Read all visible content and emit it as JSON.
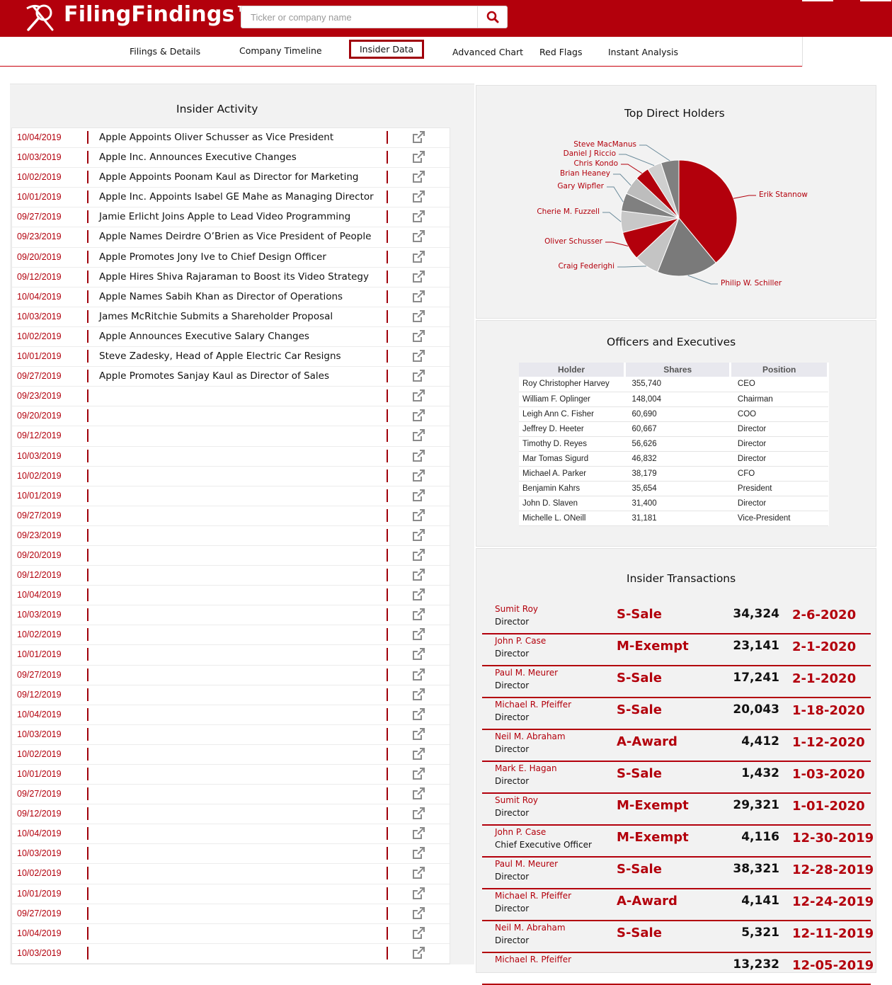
{
  "app": {
    "brand": "FilingFindings™",
    "search_placeholder": "Ticker or company name",
    "colors": {
      "accent": "#b3000c",
      "dark_red": "#a0000a",
      "panel_bg": "#f2f2f2"
    }
  },
  "nav": {
    "items": [
      "Filings & Details",
      "Company Timeline",
      "Insider Data",
      "Advanced Chart",
      "Red Flags",
      "Instant Analysis"
    ],
    "active": "Insider Data"
  },
  "activity": {
    "title": "Insider Activity",
    "rows": [
      {
        "date": "10/04/2019",
        "headline": "Apple Appoints Oliver Schusser as Vice President"
      },
      {
        "date": "10/03/2019",
        "headline": "Apple Inc. Announces Executive Changes"
      },
      {
        "date": "10/02/2019",
        "headline": "Apple Appoints Poonam Kaul as Director for Marketing"
      },
      {
        "date": "10/01/2019",
        "headline": "Apple Inc. Appoints Isabel GE Mahe as Managing Director"
      },
      {
        "date": "09/27/2019",
        "headline": "Jamie Erlicht Joins Apple to Lead Video Programming"
      },
      {
        "date": "09/23/2019",
        "headline": "Apple Names Deirdre O’Brien as Vice President of People"
      },
      {
        "date": "09/20/2019",
        "headline": "Apple Promotes Jony Ive to Chief Design Officer"
      },
      {
        "date": "09/12/2019",
        "headline": "Apple Hires Shiva Rajaraman to Boost its Video Strategy"
      },
      {
        "date": "10/04/2019",
        "headline": "Apple Names Sabih Khan as Director of Operations"
      },
      {
        "date": "10/03/2019",
        "headline": "James McRitchie Submits a Shareholder Proposal"
      },
      {
        "date": "10/02/2019",
        "headline": "Apple Announces Executive Salary Changes"
      },
      {
        "date": "10/01/2019",
        "headline": "Steve Zadesky, Head of Apple Electric Car Resigns"
      },
      {
        "date": "09/27/2019",
        "headline": "Apple Promotes Sanjay Kaul as Director of Sales"
      },
      {
        "date": "09/23/2019",
        "headline": ""
      },
      {
        "date": "09/20/2019",
        "headline": ""
      },
      {
        "date": "09/12/2019",
        "headline": ""
      },
      {
        "date": "10/03/2019",
        "headline": ""
      },
      {
        "date": "10/02/2019",
        "headline": ""
      },
      {
        "date": "10/01/2019",
        "headline": ""
      },
      {
        "date": "09/27/2019",
        "headline": ""
      },
      {
        "date": "09/23/2019",
        "headline": ""
      },
      {
        "date": "09/20/2019",
        "headline": ""
      },
      {
        "date": "09/12/2019",
        "headline": ""
      },
      {
        "date": "10/04/2019",
        "headline": ""
      },
      {
        "date": "10/03/2019",
        "headline": ""
      },
      {
        "date": "10/02/2019",
        "headline": ""
      },
      {
        "date": "10/01/2019",
        "headline": ""
      },
      {
        "date": "09/27/2019",
        "headline": ""
      },
      {
        "date": "09/12/2019",
        "headline": ""
      },
      {
        "date": "10/04/2019",
        "headline": ""
      },
      {
        "date": "10/03/2019",
        "headline": ""
      },
      {
        "date": "10/02/2019",
        "headline": ""
      },
      {
        "date": "10/01/2019",
        "headline": ""
      },
      {
        "date": "09/27/2019",
        "headline": ""
      },
      {
        "date": "09/12/2019",
        "headline": ""
      },
      {
        "date": "10/04/2019",
        "headline": ""
      },
      {
        "date": "10/03/2019",
        "headline": ""
      },
      {
        "date": "10/02/2019",
        "headline": ""
      },
      {
        "date": "10/01/2019",
        "headline": ""
      },
      {
        "date": "09/27/2019",
        "headline": ""
      },
      {
        "date": "10/04/2019",
        "headline": ""
      },
      {
        "date": "10/03/2019",
        "headline": ""
      }
    ]
  },
  "holders": {
    "title": "Top Direct Holders",
    "chart_data": {
      "type": "pie",
      "slices": [
        {
          "label": "Erik Stannow",
          "value": 39,
          "color": "#b3000c"
        },
        {
          "label": "Philip W. Schiller",
          "value": 17,
          "color": "#7a7a7a"
        },
        {
          "label": "Craig Federighi",
          "value": 7,
          "color": "#c4c4c4"
        },
        {
          "label": "Oliver Schusser",
          "value": 8,
          "color": "#b3000c"
        },
        {
          "label": "Cherie M. Fuzzell",
          "value": 6,
          "color": "#c8c8c8"
        },
        {
          "label": "Gary Wipfler",
          "value": 5,
          "color": "#808080"
        },
        {
          "label": "Brian Heaney",
          "value": 5,
          "color": "#bdbdbd"
        },
        {
          "label": "Chris Kondo",
          "value": 4,
          "color": "#b3000c"
        },
        {
          "label": "Daniel J Riccio",
          "value": 4,
          "color": "#cfcfcf"
        },
        {
          "label": "Steve MacManus",
          "value": 5,
          "color": "#808080"
        }
      ]
    }
  },
  "officers": {
    "title": "Officers and Executives",
    "columns": [
      "Holder",
      "Shares",
      "Position"
    ],
    "rows": [
      {
        "holder": "Roy Christopher Harvey",
        "shares": "355,740",
        "position": "CEO"
      },
      {
        "holder": "William F. Oplinger",
        "shares": "148,004",
        "position": "Chairman"
      },
      {
        "holder": "Leigh Ann C. Fisher",
        "shares": "60,690",
        "position": "COO"
      },
      {
        "holder": "Jeffrey D. Heeter",
        "shares": "60,667",
        "position": "Director"
      },
      {
        "holder": "Timothy D. Reyes",
        "shares": "56,626",
        "position": "Director"
      },
      {
        "holder": "Mar Tomas Sigurd",
        "shares": "46,832",
        "position": "Director"
      },
      {
        "holder": "Michael A. Parker",
        "shares": "38,179",
        "position": "CFO"
      },
      {
        "holder": "Benjamin Kahrs",
        "shares": "35,654",
        "position": "President"
      },
      {
        "holder": "John D. Slaven",
        "shares": "31,400",
        "position": "Director"
      },
      {
        "holder": "Michelle L. ONeill",
        "shares": "31,181",
        "position": "Vice-President"
      }
    ]
  },
  "transactions": {
    "title": "Insider Transactions",
    "rows": [
      {
        "name": "Sumit Roy",
        "role": "Director",
        "type": "S-Sale",
        "shares": "34,324",
        "date": "2-6-2020"
      },
      {
        "name": "John P. Case",
        "role": "Director",
        "type": "M-Exempt",
        "shares": "23,141",
        "date": "2-1-2020"
      },
      {
        "name": "Paul M. Meurer",
        "role": "Director",
        "type": "S-Sale",
        "shares": "17,241",
        "date": "2-1-2020"
      },
      {
        "name": "Michael R. Pfeiffer",
        "role": "Director",
        "type": "S-Sale",
        "shares": "20,043",
        "date": "1-18-2020"
      },
      {
        "name": "Neil M. Abraham",
        "role": "Director",
        "type": "A-Award",
        "shares": "4,412",
        "date": "1-12-2020"
      },
      {
        "name": "Mark E. Hagan",
        "role": "Director",
        "type": "S-Sale",
        "shares": "1,432",
        "date": "1-03-2020"
      },
      {
        "name": "Sumit Roy",
        "role": "Director",
        "type": "M-Exempt",
        "shares": "29,321",
        "date": "1-01-2020"
      },
      {
        "name": "John P. Case",
        "role": "Chief Executive Officer",
        "type": "M-Exempt",
        "shares": "4,116",
        "date": "12-30-2019"
      },
      {
        "name": "Paul M. Meurer",
        "role": "Director",
        "type": "S-Sale",
        "shares": "38,321",
        "date": "12-28-2019"
      },
      {
        "name": "Michael R. Pfeiffer",
        "role": "Director",
        "type": "A-Award",
        "shares": "4,141",
        "date": "12-24-2019"
      },
      {
        "name": "Neil M. Abraham",
        "role": "Director",
        "type": "S-Sale",
        "shares": "5,321",
        "date": "12-11-2019"
      },
      {
        "name": "Michael R. Pfeiffer",
        "role": "",
        "type": "",
        "shares": "13,232",
        "date": "12-05-2019"
      }
    ]
  }
}
